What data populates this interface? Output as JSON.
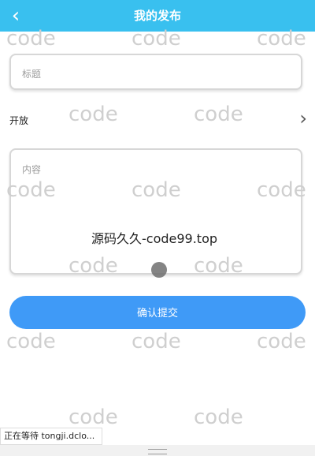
{
  "header": {
    "title": "我的发布",
    "back_icon": "chevron-left-icon"
  },
  "form": {
    "title_placeholder": "标题",
    "open_label": "开放",
    "open_chevron": "chevron-right-icon",
    "content_placeholder": "内容",
    "submit_label": "确认提交"
  },
  "overlay": {
    "promo_text": "源码久久-code99.top",
    "watermark": "code"
  },
  "status": {
    "text": "正在等待 tongji.dclo..."
  },
  "colors": {
    "header": "#39c0ef",
    "button": "#3f9af7"
  }
}
